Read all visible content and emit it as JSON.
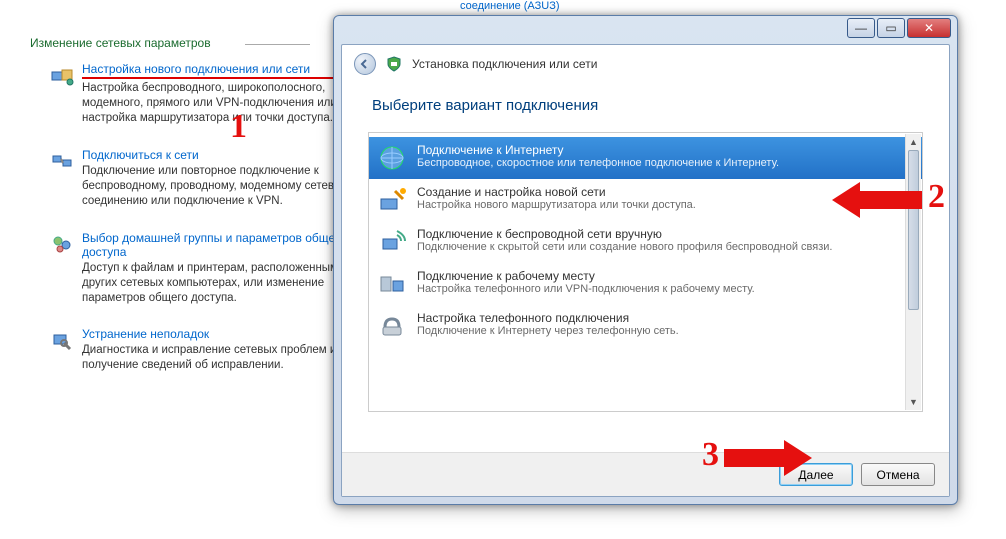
{
  "bg": {
    "header_link": "соединение (АЗUЗ)",
    "section_title": "Изменение сетевых параметров",
    "items": [
      {
        "link": "Настройка нового подключения или сети",
        "desc": "Настройка беспроводного, широкополосного, модемного, прямого или VPN-подключения или же настройка маршрутизатора или точки доступа."
      },
      {
        "link": "Подключиться к сети",
        "desc": "Подключение или повторное подключение к беспроводному, проводному, модемному сетевому соединению или подключение к VPN."
      },
      {
        "link": "Выбор домашней группы и параметров общего доступа",
        "desc": "Доступ к файлам и принтерам, расположенным на других сетевых компьютерах, или изменение параметров общего доступа."
      },
      {
        "link": "Устранение неполадок",
        "desc": "Диагностика и исправление сетевых проблем или получение сведений об исправлении."
      }
    ]
  },
  "dialog": {
    "nav_title": "Установка подключения или сети",
    "heading": "Выберите вариант подключения",
    "options": [
      {
        "title": "Подключение к Интернету",
        "desc": "Беспроводное, скоростное или телефонное подключение к Интернету."
      },
      {
        "title": "Создание и настройка новой сети",
        "desc": "Настройка нового маршрутизатора или точки доступа."
      },
      {
        "title": "Подключение к беспроводной сети вручную",
        "desc": "Подключение к скрытой сети или создание нового профиля беспроводной связи."
      },
      {
        "title": "Подключение к рабочему месту",
        "desc": "Настройка телефонного или VPN-подключения к рабочему месту."
      },
      {
        "title": "Настройка телефонного подключения",
        "desc": "Подключение к Интернету через телефонную сеть."
      }
    ],
    "buttons": {
      "next": "Далее",
      "cancel": "Отмена"
    },
    "win": {
      "min": "—",
      "max": "▭",
      "close": "✕"
    }
  },
  "annot": {
    "n1": "1",
    "n2": "2",
    "n3": "3"
  }
}
